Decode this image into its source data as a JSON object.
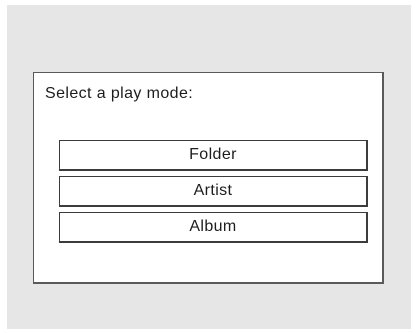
{
  "dialog": {
    "prompt": "Select a play mode:",
    "options": [
      {
        "label": "Folder"
      },
      {
        "label": "Artist"
      },
      {
        "label": "Album"
      }
    ]
  },
  "colors": {
    "screen_background": "#e6e6e6",
    "dialog_background": "#ffffff",
    "border": "#3c3c3c",
    "text": "#1c1c1c"
  }
}
